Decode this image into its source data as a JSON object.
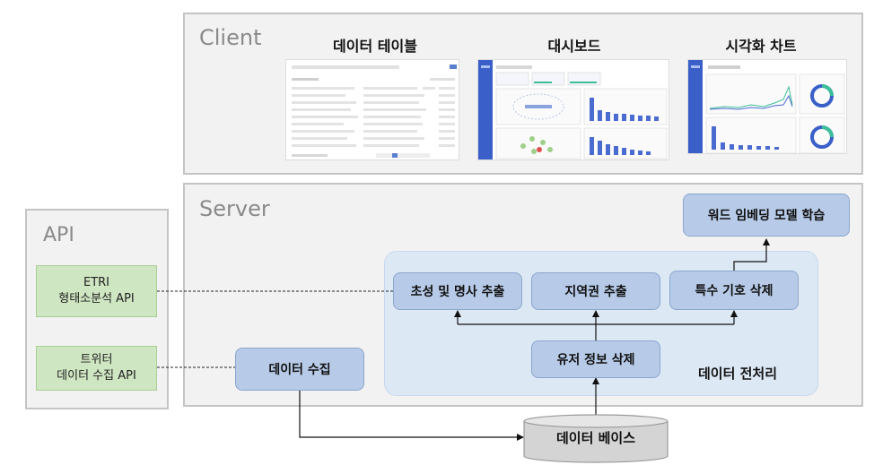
{
  "client": {
    "title": "Client",
    "shots": [
      {
        "title": "데이터 테이블"
      },
      {
        "title": "대시보드"
      },
      {
        "title": "시각화 차트"
      }
    ]
  },
  "server": {
    "title": "Server",
    "preprocess_label": "데이터 전처리",
    "nodes": {
      "word_embedding": "워드 임베딩 모델 학습",
      "choseong": "초성 및 명사 추출",
      "region": "지역권 추출",
      "special": "특수 기호 삭제",
      "user_info": "유저 정보 삭제",
      "collect": "데이터 수집"
    }
  },
  "api": {
    "title": "API",
    "etri": {
      "line1": "ETRI",
      "line2": "형태소분석 API"
    },
    "twitter": {
      "line1": "트위터",
      "line2": "데이터 수집 API"
    }
  },
  "database": {
    "label": "데이터 베이스"
  },
  "colors": {
    "node_fill": "#b7cbe8",
    "api_fill": "#cfe6c2",
    "panel_fill": "#f2f2f2",
    "region_fill": "#dde8f5"
  }
}
